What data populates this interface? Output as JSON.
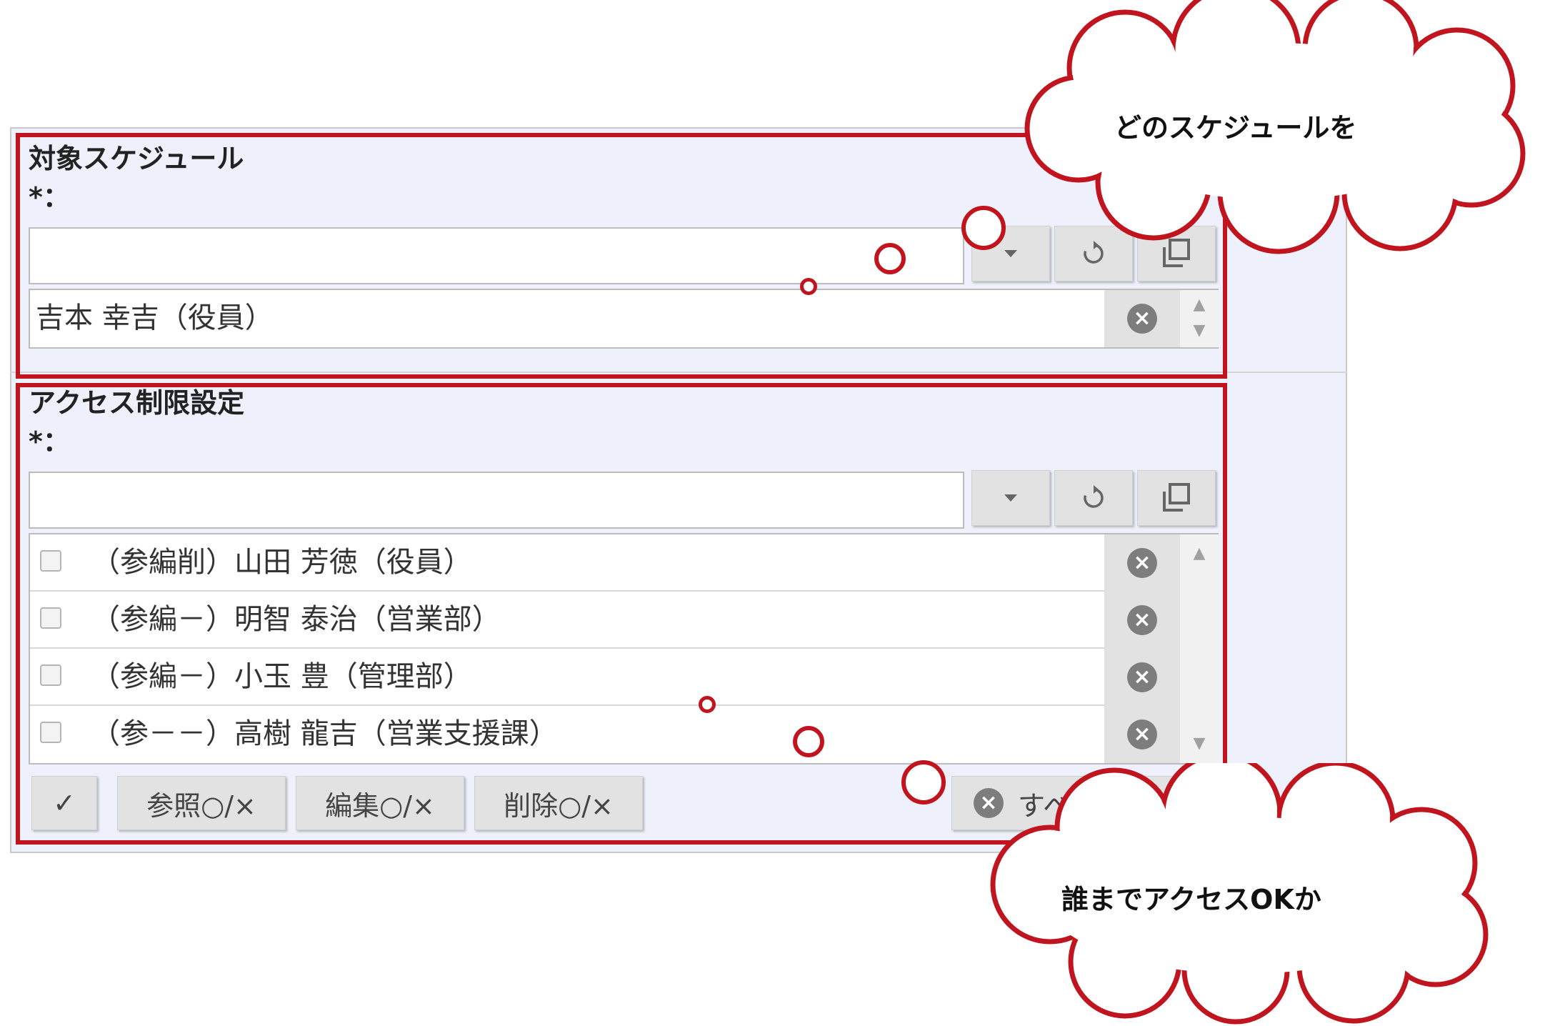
{
  "schedule_section": {
    "title": "対象スケジュール",
    "required_mark": "*：",
    "selected_value": "吉本 幸吉（役員）"
  },
  "access_section": {
    "title": "アクセス制限設定",
    "required_mark": "*：",
    "rows": [
      {
        "label": "（参編削）山田 芳徳（役員）"
      },
      {
        "label": "（参編－）明智 泰治（営業部）"
      },
      {
        "label": "（参編－）小玉 豊（管理部）"
      },
      {
        "label": "（参－－）高樹 龍吉（営業支援課）"
      }
    ],
    "buttons": {
      "check": "✓",
      "view_toggle": "参照○/×",
      "edit_toggle": "編集○/×",
      "delete_toggle": "削除○/×",
      "clear_all": "すべてクリア"
    }
  },
  "icons": {
    "dropdown": "chevron-down-icon",
    "reset": "refresh-icon",
    "popup": "window-icon",
    "clear": "clear-circle-icon"
  },
  "annotations": {
    "cloud_top": "どのスケジュールを",
    "cloud_bottom": "誰までアクセスOKか"
  },
  "colors": {
    "annotation_red": "#c0141e",
    "panel_bg": "#eef0fb",
    "button_bg": "#e2e2e2"
  }
}
